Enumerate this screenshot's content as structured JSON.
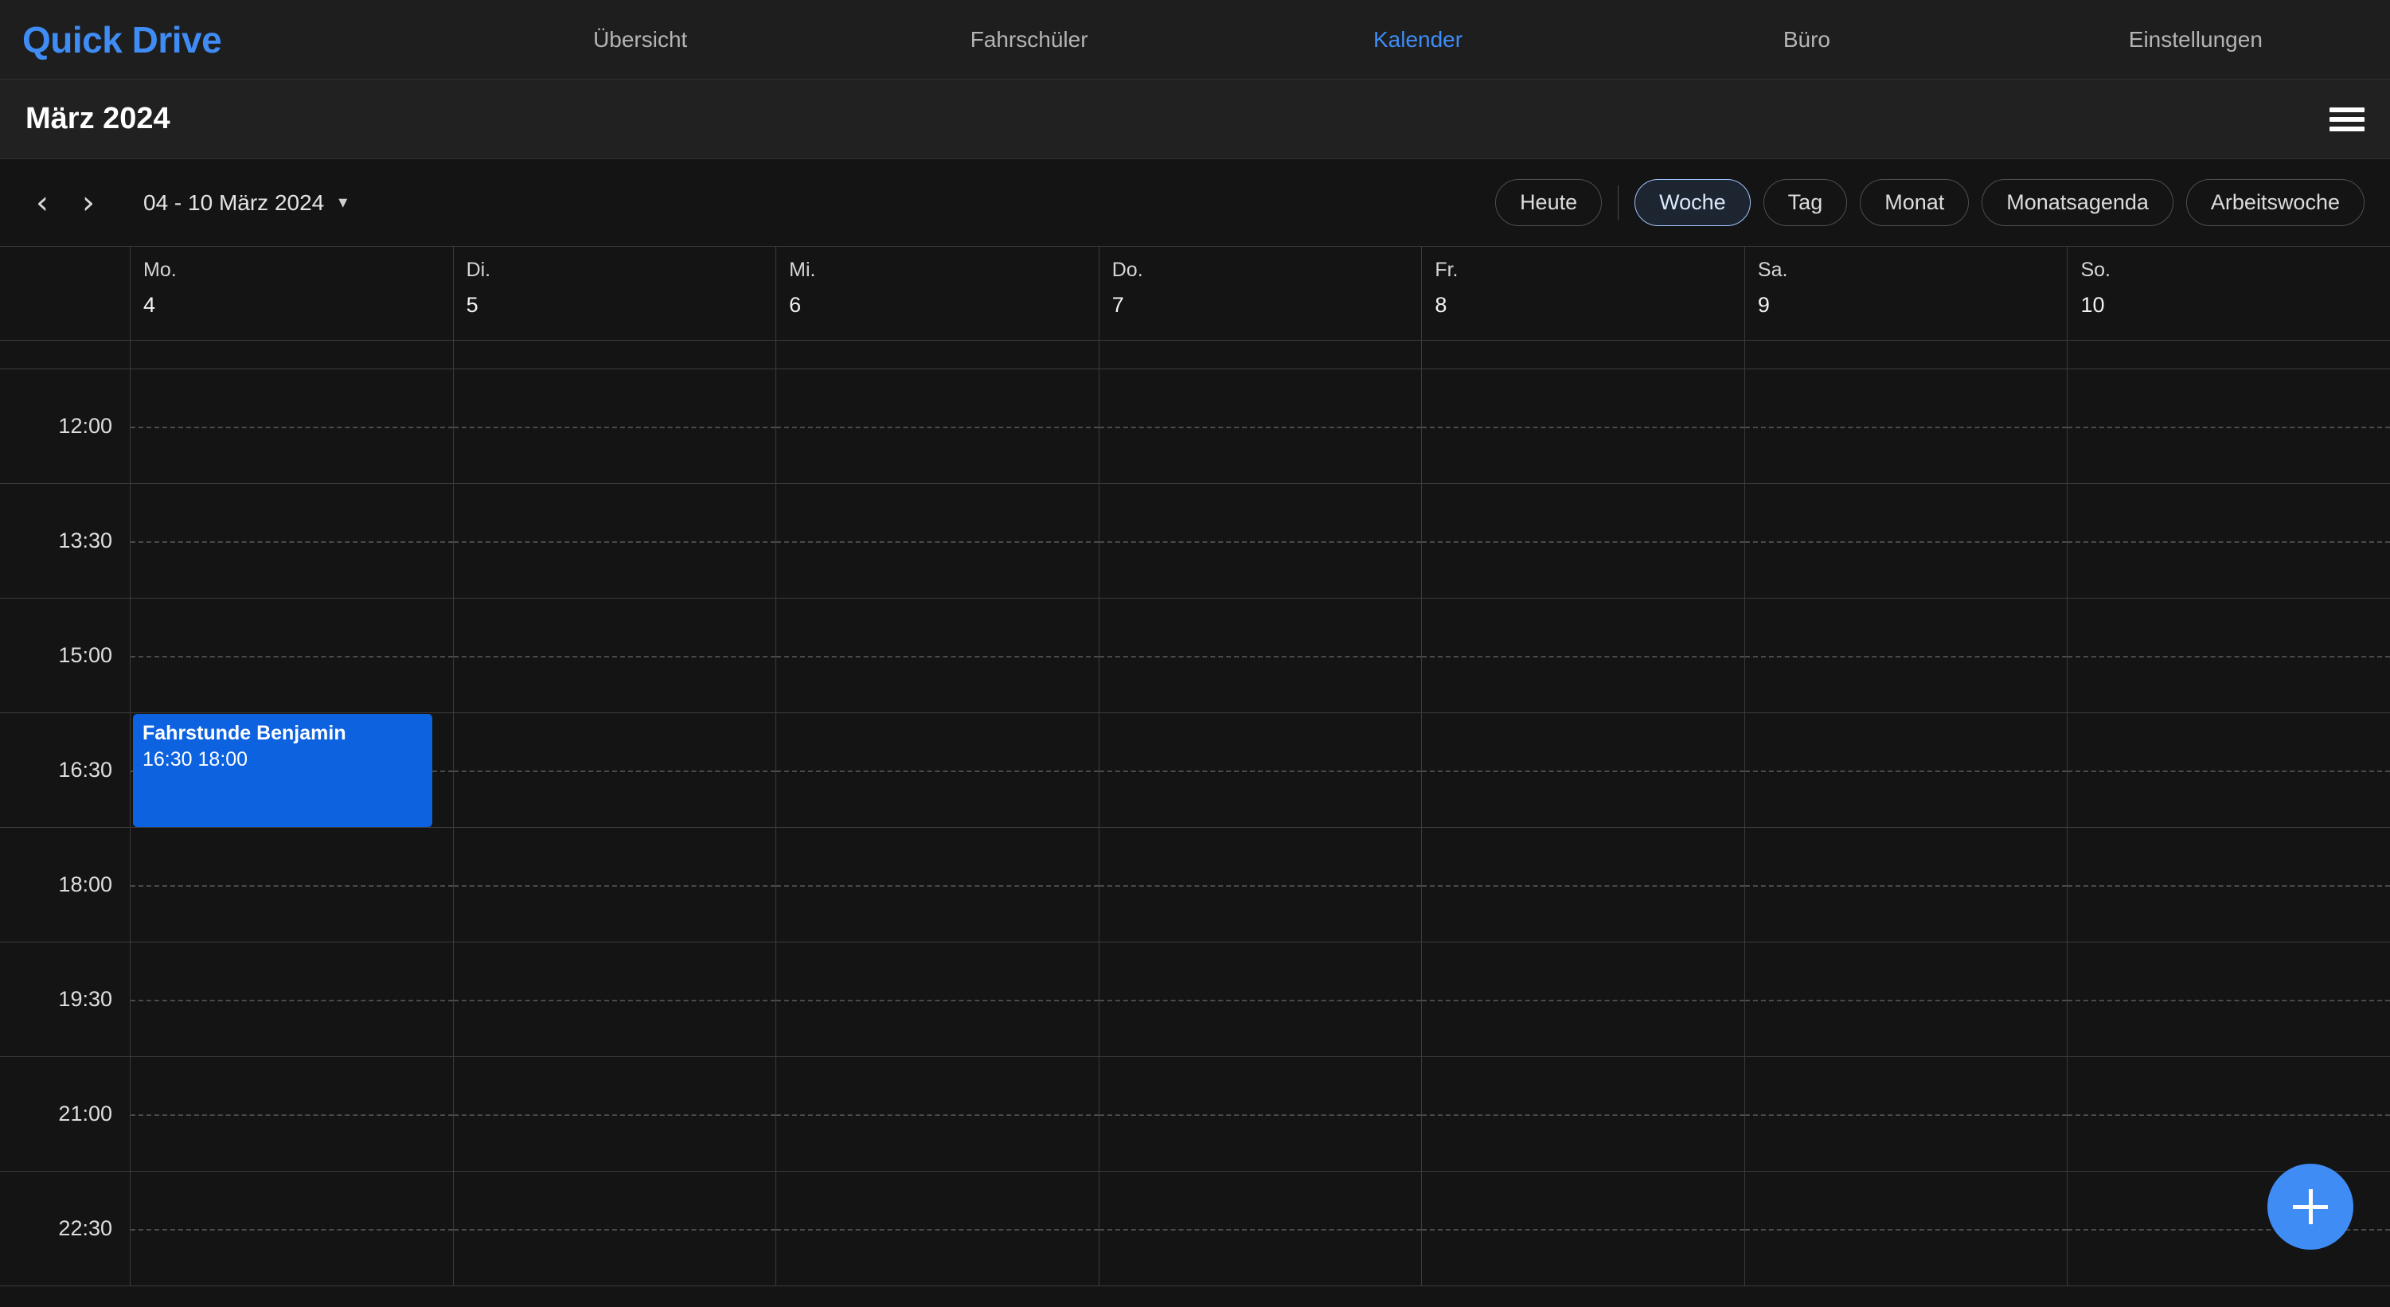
{
  "app": {
    "logo": "Quick Drive",
    "accent_color": "#3f8cf5"
  },
  "nav": {
    "items": [
      {
        "label": "Übersicht",
        "active": false
      },
      {
        "label": "Fahrschüler",
        "active": false
      },
      {
        "label": "Kalender",
        "active": true
      },
      {
        "label": "Büro",
        "active": false
      },
      {
        "label": "Einstellungen",
        "active": false
      }
    ]
  },
  "header": {
    "title": "März 2024",
    "menu_icon": "hamburger-menu-icon"
  },
  "toolbar": {
    "prev_icon": "chevron-left-icon",
    "next_icon": "chevron-right-icon",
    "date_range": "04 - 10 März 2024",
    "dropdown_icon": "chevron-down-icon",
    "views": [
      {
        "label": "Heute",
        "active": false
      },
      {
        "label": "Woche",
        "active": true
      },
      {
        "label": "Tag",
        "active": false
      },
      {
        "label": "Monat",
        "active": false
      },
      {
        "label": "Monatsagenda",
        "active": false
      },
      {
        "label": "Arbeitswoche",
        "active": false
      }
    ]
  },
  "calendar": {
    "days": [
      {
        "name": "Mo.",
        "num": "4"
      },
      {
        "name": "Di.",
        "num": "5"
      },
      {
        "name": "Mi.",
        "num": "6"
      },
      {
        "name": "Do.",
        "num": "7"
      },
      {
        "name": "Fr.",
        "num": "8"
      },
      {
        "name": "Sa.",
        "num": "9"
      },
      {
        "name": "So.",
        "num": "10"
      }
    ],
    "time_slots": [
      "12:00",
      "13:30",
      "15:00",
      "16:30",
      "18:00",
      "19:30",
      "21:00",
      "22:30"
    ],
    "events": [
      {
        "title": "Fahrstunde Benjamin",
        "time": "16:30 18:00",
        "day_index": 0,
        "slot_index": 3,
        "color": "#0d62e0"
      }
    ]
  },
  "fab": {
    "icon": "plus-icon",
    "color": "#3f8cf5"
  }
}
